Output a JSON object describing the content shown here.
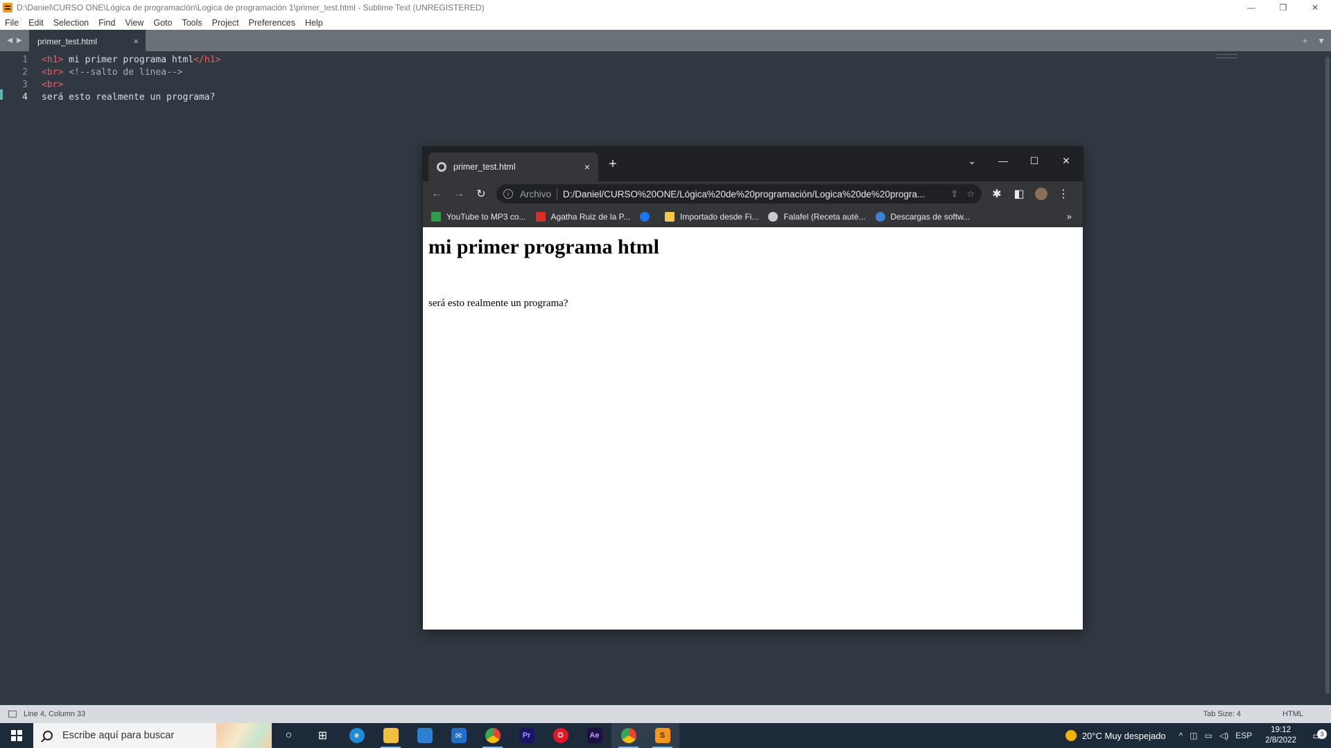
{
  "window": {
    "title": "D:\\Daniel\\CURSO ONE\\Lógica de programación\\Logica de programación 1\\primer_test.html - Sublime Text (UNREGISTERED)"
  },
  "menu": [
    "File",
    "Edit",
    "Selection",
    "Find",
    "View",
    "Goto",
    "Tools",
    "Project",
    "Preferences",
    "Help"
  ],
  "editor_tab": {
    "name": "primer_test.html",
    "close": "×"
  },
  "editor": {
    "line_numbers": [
      "1",
      "2",
      "3",
      "4"
    ],
    "current_line": 4,
    "lines": [
      {
        "open": "<h1>",
        "text": " mi primer programa html",
        "close": "</h1>"
      },
      {
        "open": "<br>",
        "comment": " <!--salto de linea-->"
      },
      {
        "open": "<br>"
      },
      {
        "text": "será esto realmente un programa?"
      }
    ]
  },
  "statusbar": {
    "position": "Line 4, Column 33",
    "tab_size": "Tab Size: 4",
    "syntax": "HTML"
  },
  "browser": {
    "tab_title": "primer_test.html",
    "tab_close": "×",
    "new_tab": "+",
    "url_scheme": "Archivo",
    "url": "D:/Daniel/CURSO%20ONE/Lógica%20de%20programación/Logica%20de%20progra...",
    "bookmarks": [
      {
        "label": "YouTube to MP3 co...",
        "color": "#2e9e47"
      },
      {
        "label": "Agatha Ruiz de la P...",
        "color": "#d93025"
      },
      {
        "label": "",
        "color": "#1877f2"
      },
      {
        "label": "Importado desde Fi...",
        "color": "#f2c94c"
      },
      {
        "label": "Falafel (Receta autè...",
        "color": "#c8cacd"
      },
      {
        "label": "Descargas de softw...",
        "color": "#3b82d6"
      }
    ],
    "bookmarks_more": "»",
    "page": {
      "heading": "mi primer programa html",
      "paragraph": "será esto realmente un programa?"
    }
  },
  "taskbar": {
    "search_placeholder": "Escribe aquí para buscar",
    "apps": [
      {
        "name": "cortana",
        "glyph": "○",
        "color": "transparent"
      },
      {
        "name": "task-view",
        "glyph": "⊞",
        "color": "transparent"
      },
      {
        "name": "edge",
        "glyph": "e",
        "color": "#1e8bd6"
      },
      {
        "name": "file-explorer",
        "glyph": "",
        "color": "#f0c040"
      },
      {
        "name": "store",
        "glyph": "",
        "color": "#2d7fd3"
      },
      {
        "name": "mail",
        "glyph": "✉",
        "color": "#1f6fc4"
      },
      {
        "name": "chrome",
        "glyph": "",
        "color": "#34a853"
      },
      {
        "name": "premiere",
        "glyph": "Pr",
        "color": "#1b1464"
      },
      {
        "name": "opera",
        "glyph": "O",
        "color": "#e0162b"
      },
      {
        "name": "after-effects",
        "glyph": "Ae",
        "color": "#1d1045"
      },
      {
        "name": "chrome-active",
        "glyph": "",
        "color": "#34a853"
      },
      {
        "name": "sublime",
        "glyph": "S",
        "color": "#f29718"
      }
    ],
    "weather": "20°C  Muy despejado",
    "language": "ESP",
    "time": "19:12",
    "date": "2/8/2022",
    "notifications": "3"
  }
}
